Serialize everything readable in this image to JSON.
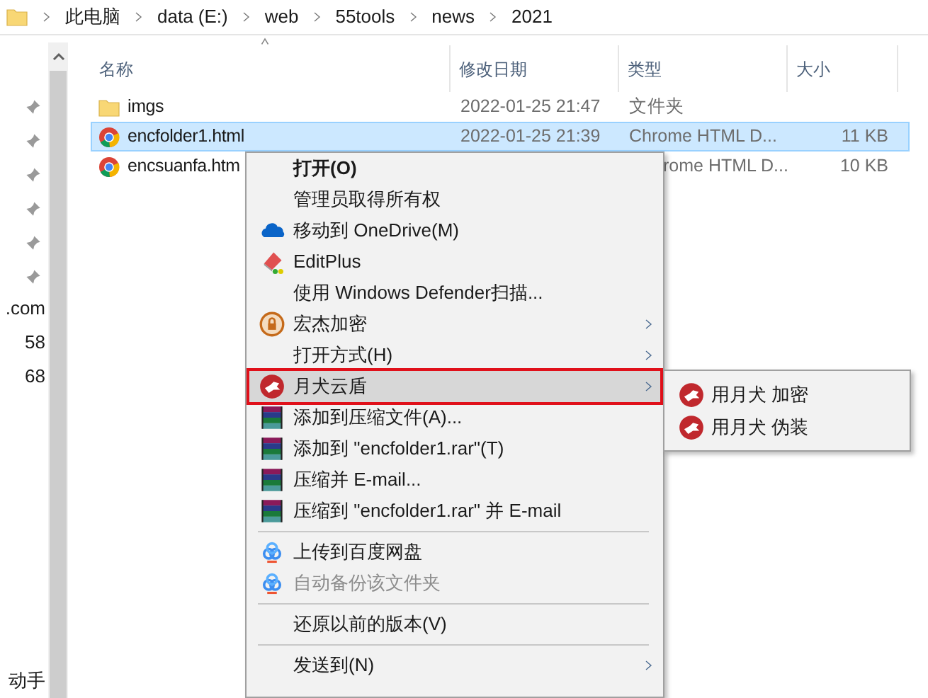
{
  "breadcrumb": [
    "此电脑",
    "data (E:)",
    "web",
    "55tools",
    "news",
    "2021"
  ],
  "nav_items": [
    ".com",
    "58",
    "68",
    "动手"
  ],
  "table": {
    "columns": [
      "名称",
      "修改日期",
      "类型",
      "大小"
    ],
    "rows": [
      {
        "kind": "folder",
        "name": "imgs",
        "modified": "2022-01-25 21:47",
        "type": "文件夹",
        "selected": false
      },
      {
        "kind": "file",
        "name": "encfolder1.html",
        "modified": "2022-01-25 21:39",
        "type": "Chrome HTML D...",
        "size": "11 KB",
        "selected": true
      },
      {
        "kind": "file",
        "name": "encsuanfa.htm",
        "type": "rome HTML D...",
        "size": "10 KB",
        "selected": false
      }
    ]
  },
  "context_menu": [
    {
      "kind": "plain",
      "label": "打开(O)",
      "selected": false,
      "submenu": false,
      "disabled": false
    },
    {
      "kind": "plain",
      "label": "管理员取得所有权",
      "selected": false,
      "submenu": false,
      "disabled": false
    },
    {
      "kind": "onedrive",
      "label": "移动到 OneDrive(M)",
      "selected": false,
      "submenu": false,
      "disabled": false
    },
    {
      "kind": "editplus",
      "label": "EditPlus",
      "selected": false,
      "submenu": false,
      "disabled": false
    },
    {
      "kind": "plain",
      "label": "使用 Windows Defender扫描...",
      "selected": false,
      "submenu": false,
      "disabled": false
    },
    {
      "kind": "lock",
      "label": "宏杰加密",
      "selected": false,
      "submenu": true,
      "disabled": false
    },
    {
      "kind": "plain",
      "label": "打开方式(H)",
      "selected": false,
      "submenu": true,
      "disabled": false
    },
    {
      "kind": "shield",
      "label": "月犬云盾",
      "selected": true,
      "submenu": true,
      "disabled": false
    },
    {
      "kind": "archive",
      "label": "添加到压缩文件(A)...",
      "selected": false,
      "submenu": false,
      "disabled": false
    },
    {
      "kind": "archive",
      "label": "添加到 \"encfolder1.rar\"(T)",
      "selected": false,
      "submenu": false,
      "disabled": false
    },
    {
      "kind": "archive",
      "label": "压缩并 E-mail...",
      "selected": false,
      "submenu": false,
      "disabled": false
    },
    {
      "kind": "archive",
      "label": "压缩到 \"encfolder1.rar\" 并 E-mail",
      "selected": false,
      "submenu": false,
      "disabled": false
    },
    {
      "kind": "separator"
    },
    {
      "kind": "cloud",
      "label": "上传到百度网盘",
      "selected": false,
      "submenu": false,
      "disabled": false
    },
    {
      "kind": "cloud",
      "label": "自动备份该文件夹",
      "selected": false,
      "submenu": false,
      "disabled": true
    },
    {
      "kind": "separator"
    },
    {
      "kind": "plain",
      "label": "还原以前的版本(V)",
      "selected": false,
      "submenu": false,
      "disabled": false
    },
    {
      "kind": "separator"
    },
    {
      "kind": "plain",
      "label": "发送到(N)",
      "selected": false,
      "submenu": true,
      "disabled": false
    }
  ],
  "submenu": [
    {
      "label": "用月犬 加密"
    },
    {
      "label": "用月犬 伪装"
    }
  ]
}
